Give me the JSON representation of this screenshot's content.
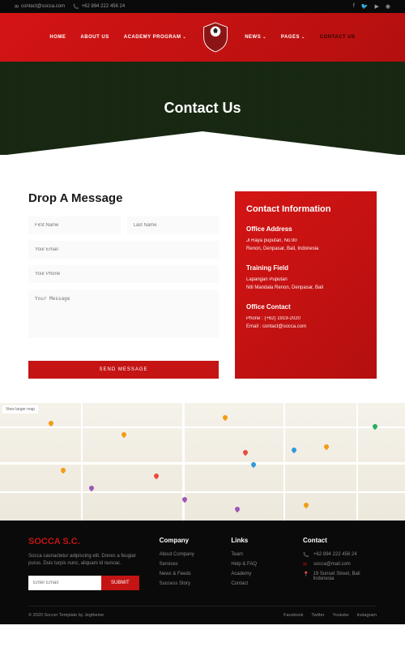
{
  "topbar": {
    "email": "contact@socca.com",
    "phone": "+62 894 222 456 24"
  },
  "nav": {
    "home": "HOME",
    "about": "ABOUT US",
    "academy": "ACADEMY PROGRAM",
    "news": "NEWS",
    "pages": "PAGES",
    "contact": "CONTACT US"
  },
  "hero": {
    "title": "Contact Us"
  },
  "form": {
    "heading": "Drop A Message",
    "first_name": "First Name",
    "last_name": "Last Name",
    "email": "Your Email",
    "phone": "Your Phone",
    "message": "Your Message",
    "submit": "SEND MESSAGE"
  },
  "info": {
    "heading": "Contact Information",
    "addr_title": "Office Address",
    "addr_line1": "Jl Raya puputan, No.90",
    "addr_line2": "Renon, Denpasar, Bali, Indonesia",
    "field_title": "Training Field",
    "field_line1": "Lapangan Puputan",
    "field_line2": "Niti Mandala Renon, Denpasar, Bali",
    "contact_title": "Office Contact",
    "contact_phone": "Phone : (+62) 1919-2020",
    "contact_email": "Email : contact@socca.com"
  },
  "map": {
    "view_larger": "View larger map"
  },
  "footer": {
    "brand": "SOCCA S.C.",
    "desc": "Socca casnactetur adipiscing elit. Donec a feugiat purus. Duis turpis nunc, aliquam id nuncac.",
    "email_ph": "Enter Email",
    "submit": "SUBMIT",
    "company": {
      "title": "Company",
      "l1": "About Company",
      "l2": "Services",
      "l3": "News & Feeds",
      "l4": "Success Story"
    },
    "links": {
      "title": "Links",
      "l1": "Team",
      "l2": "Help & FAQ",
      "l3": "Academy",
      "l4": "Contact"
    },
    "contact": {
      "title": "Contact",
      "phone": "+62 894 222 456 24",
      "email": "socca@mail.com",
      "addr": "19 Sunset Street, Bali Indonesia"
    },
    "copyright": "© 2020 Soccer Template by Jegtheme",
    "social": {
      "fb": "Facebook",
      "tw": "Twitter",
      "yt": "Youtube",
      "ig": "Instagram"
    }
  }
}
